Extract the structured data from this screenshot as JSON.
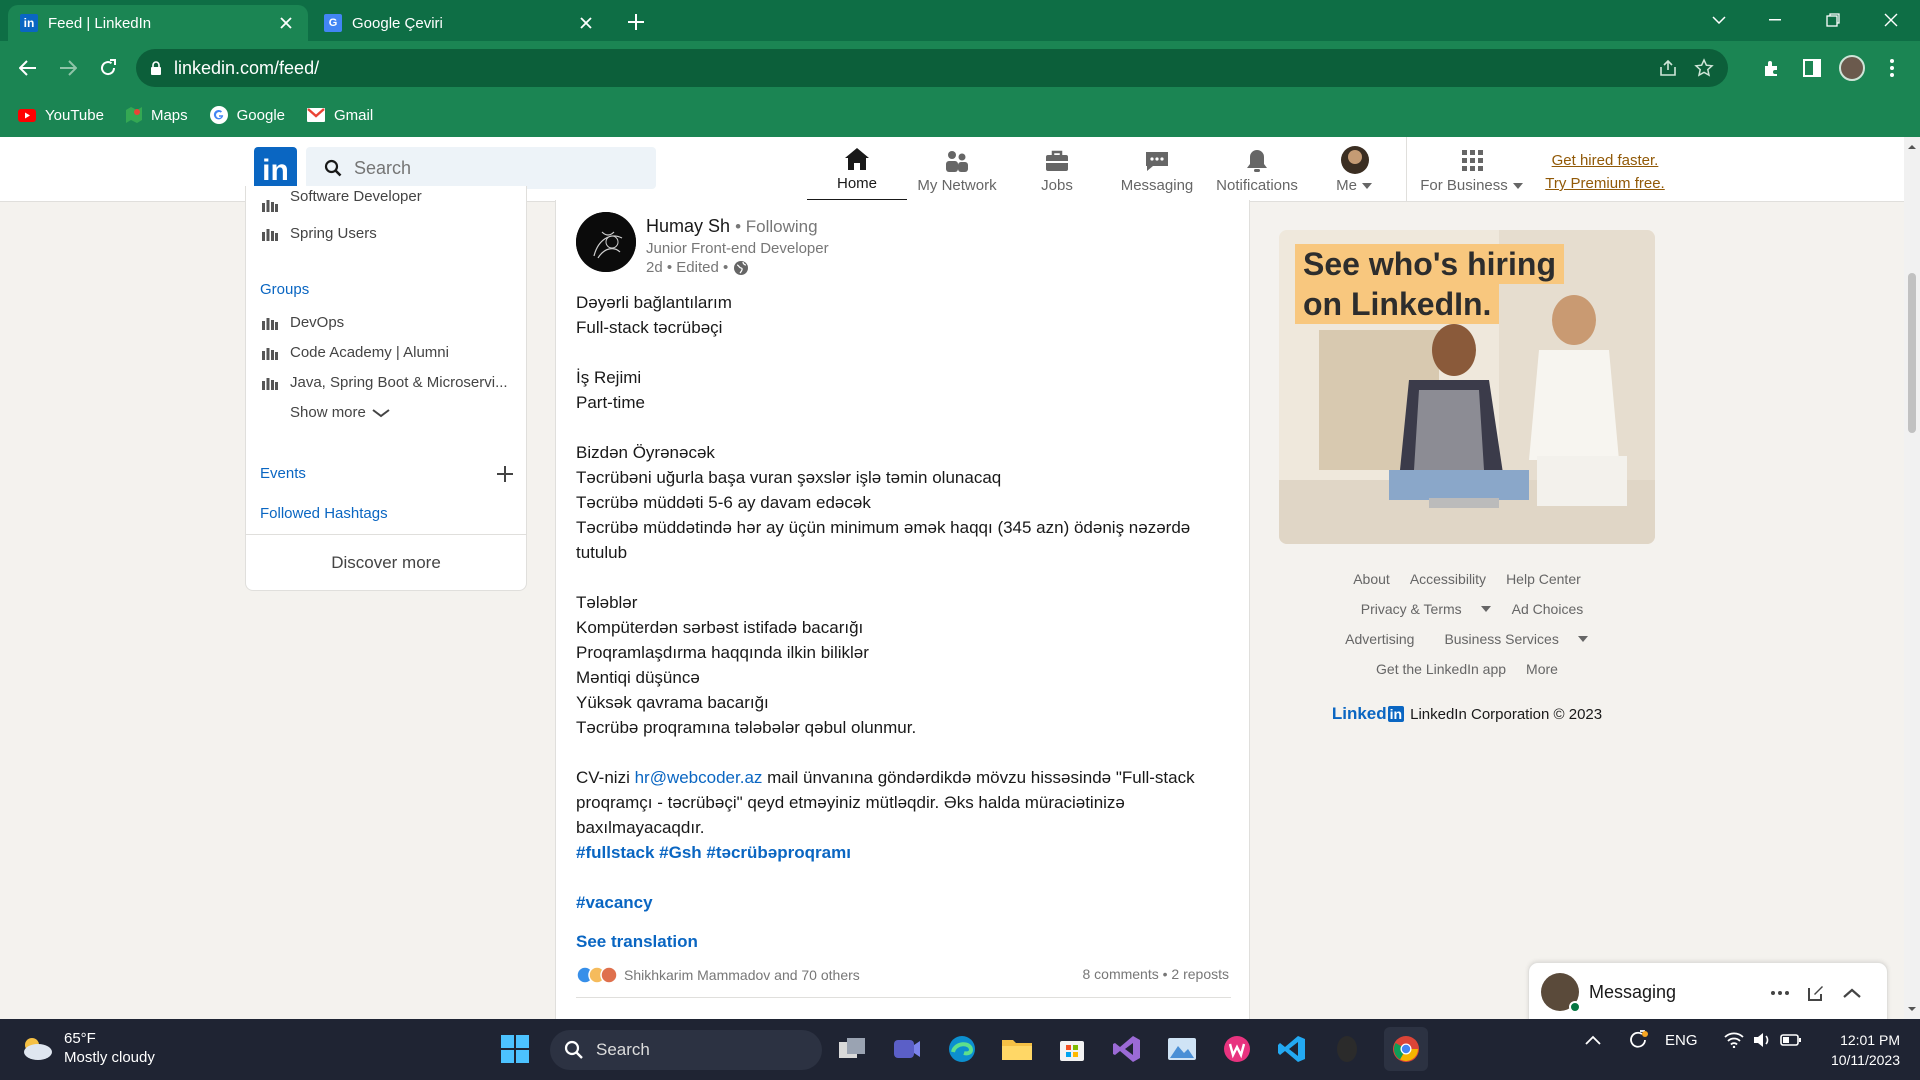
{
  "browser": {
    "tabs": [
      {
        "title": "Feed | LinkedIn",
        "active": true
      },
      {
        "title": "Google Çeviri",
        "active": false
      }
    ],
    "url": "linkedin.com/feed/",
    "bookmarks": [
      {
        "label": "YouTube",
        "icon": "youtube-icon"
      },
      {
        "label": "Maps",
        "icon": "maps-icon"
      },
      {
        "label": "Google",
        "icon": "google-icon"
      },
      {
        "label": "Gmail",
        "icon": "gmail-icon"
      }
    ]
  },
  "header": {
    "search_placeholder": "Search",
    "nav": {
      "home": "Home",
      "network": "My Network",
      "jobs": "Jobs",
      "messaging": "Messaging",
      "notifications": "Notifications",
      "me": "Me",
      "business": "For Business"
    },
    "premium_line1": "Get hired faster.",
    "premium_line2": "Try Premium free."
  },
  "left": {
    "top_items": [
      "Software Developer",
      "Spring Users"
    ],
    "groups_heading": "Groups",
    "groups": [
      "DevOps",
      "Code Academy | Alumni",
      "Java, Spring Boot & Microservi..."
    ],
    "show_more": "Show more",
    "events": "Events",
    "hashtags": "Followed Hashtags",
    "discover": "Discover more"
  },
  "post": {
    "author": "Humay Sh",
    "following": "• Following",
    "headline": "Junior Front-end Developer",
    "time": "2d • Edited •",
    "lines": [
      "Dəyərli bağlantılarım",
      "Full-stack təcrübəçi",
      "",
      "İş Rejimi",
      "Part-time",
      "",
      "Bizdən Öyrənəcək",
      "Təcrübəni uğurla başa vuran şəxslər işlə təmin olunacaq",
      "Təcrübə müddəti 5-6 ay davam edəcək",
      "Təcrübə müddətində hər ay üçün minimum əmək haqqı (345 azn) ödəniş nəzərdə",
      "tutulub",
      "",
      "Tələblər",
      "Kompüterdən sərbəst istifadə bacarığı",
      "Proqramlaşdırma haqqında ilkin biliklər",
      "Məntiqi düşüncə",
      "Yüksək qavrama bacarığı",
      "Təcrübə proqramına tələbələr qəbul olunmur."
    ],
    "cv_prefix": "CV-nizi ",
    "cv_email": "hr@webcoder.az",
    "cv_rest1": " mail ünvanına göndərdikdə mövzu hissəsində \"Full-stack",
    "cv_rest2": "proqramçı - təcrübəçi\" qeyd etməyiniz mütləqdir. Əks halda müraciətinizə",
    "cv_rest3": "baxılmayacaqdır.",
    "hashtags": "#fullstack #Gsh #təcrübəproqramı",
    "hashtag2": "#vacancy",
    "see_translation": "See translation",
    "reactions_text": "Shikhkarim Mammadov and 70 others",
    "counts": "8 comments • 2 reposts"
  },
  "ad": {
    "line1": "See who's hiring",
    "line2": "on LinkedIn."
  },
  "footer": {
    "row1": [
      "About",
      "Accessibility",
      "Help Center"
    ],
    "row2": [
      "Privacy & Terms",
      "Ad Choices"
    ],
    "row3": [
      "Advertising",
      "Business Services"
    ],
    "row4": [
      "Get the LinkedIn app",
      "More"
    ],
    "brand": "Linked",
    "corp": "LinkedIn Corporation © 2023"
  },
  "messaging": {
    "title": "Messaging"
  },
  "taskbar": {
    "temp": "65°F",
    "weather": "Mostly cloudy",
    "search": "Search",
    "lang": "ENG",
    "time": "12:01 PM",
    "date": "10/11/2023"
  },
  "colors": {
    "linkedin_blue": "#0a66c2",
    "chrome_green": "#1b8553",
    "premium_gold": "#915907"
  }
}
